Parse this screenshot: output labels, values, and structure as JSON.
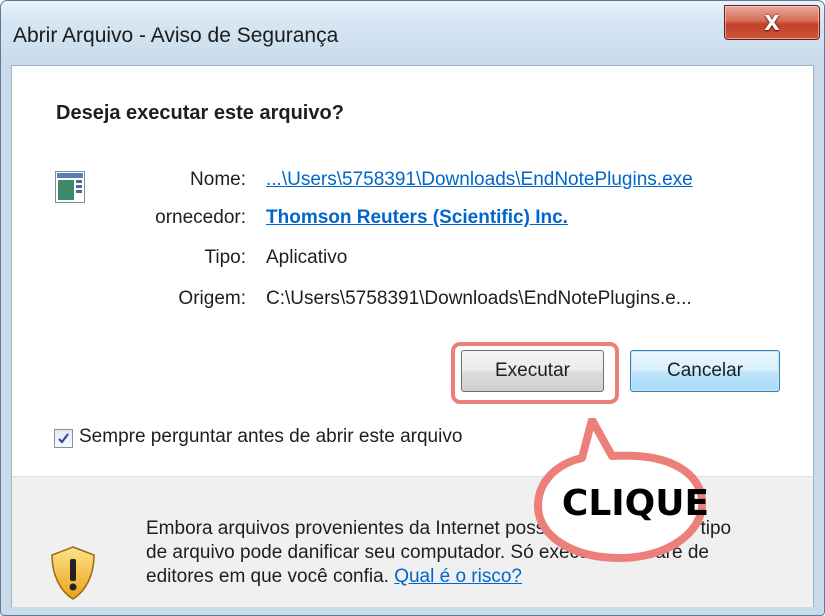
{
  "window": {
    "title": "Abrir Arquivo - Aviso de Segurança",
    "close_label": "X"
  },
  "dialog": {
    "heading": "Deseja executar este arquivo?",
    "fields": {
      "nome_label": "Nome:",
      "nome_value": "...\\Users\\5758391\\Downloads\\EndNotePlugins.exe",
      "fornecedor_label": "ornecedor:",
      "fornecedor_value": "Thomson Reuters (Scientific) Inc.",
      "tipo_label": "Tipo:",
      "tipo_value": "Aplicativo",
      "origem_label": "Origem:",
      "origem_value": "C:\\Users\\5758391\\Downloads\\EndNotePlugins.e..."
    },
    "buttons": {
      "execute": "Executar",
      "cancel": "Cancelar"
    },
    "checkbox": {
      "label": "Sempre perguntar antes de abrir este arquivo",
      "checked": true
    },
    "warning": {
      "text_line1": "Embora arquivos provenientes da Internet possam ser úteis, este tipo",
      "text_line2": "de arquivo pode danificar seu computador. Só execute software de",
      "text_line3": "editores em que você confia.",
      "link": "Qual é o risco?"
    }
  },
  "annotation": {
    "callout_text": "CLIQUE",
    "color": "#ec7f7a"
  },
  "icons": {
    "file": "application-window-icon",
    "shield": "security-shield-warning-icon",
    "close": "close-icon",
    "checkbox": "checkmark-icon"
  }
}
